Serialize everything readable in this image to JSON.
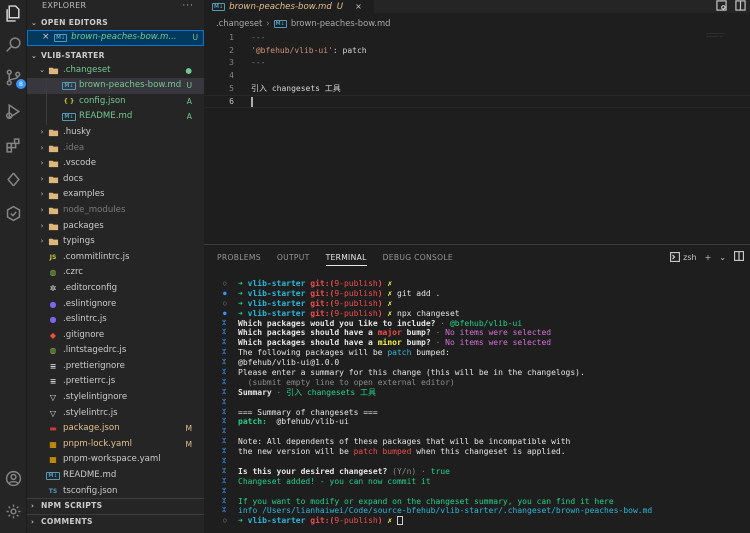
{
  "activity": {
    "scm_badge": "8"
  },
  "sidebar": {
    "title": "EXPLORER",
    "more": "···",
    "open_editors": {
      "header": "OPEN EDITORS",
      "items": [
        {
          "close": "×",
          "name": "brown-peaches-bow.m...",
          "status": "U"
        }
      ]
    },
    "project_header": "VLIB-STARTER",
    "tree": [
      {
        "type": "folder",
        "name": ".changeset",
        "open": true,
        "depth": 0,
        "status": "●",
        "color": "untracked"
      },
      {
        "type": "md",
        "name": "brown-peaches-bow.md",
        "depth": 1,
        "status": "U",
        "color": "untracked",
        "selected": true
      },
      {
        "type": "json",
        "name": "config.json",
        "depth": 1,
        "status": "A",
        "color": "add"
      },
      {
        "type": "md",
        "name": "README.md",
        "depth": 1,
        "status": "A",
        "color": "add"
      },
      {
        "type": "folder",
        "name": ".husky",
        "depth": 0
      },
      {
        "type": "folder",
        "name": ".idea",
        "depth": 0,
        "dim": true
      },
      {
        "type": "folder",
        "name": ".vscode",
        "depth": 0
      },
      {
        "type": "folder",
        "name": "docs",
        "depth": 0
      },
      {
        "type": "folder",
        "name": "examples",
        "depth": 0
      },
      {
        "type": "folder",
        "name": "node_modules",
        "depth": 0,
        "dim": true
      },
      {
        "type": "folder",
        "name": "packages",
        "depth": 0
      },
      {
        "type": "folder",
        "name": "typings",
        "depth": 0
      },
      {
        "type": "js",
        "name": ".commitlintrc.js",
        "depth": 0
      },
      {
        "type": "cfg",
        "name": ".czrc",
        "depth": 0
      },
      {
        "type": "editorconfig",
        "name": ".editorconfig",
        "depth": 0
      },
      {
        "type": "eslint",
        "name": ".eslintignore",
        "depth": 0
      },
      {
        "type": "eslint",
        "name": ".eslintrc.js",
        "depth": 0
      },
      {
        "type": "git",
        "name": ".gitignore",
        "depth": 0
      },
      {
        "type": "cfg",
        "name": ".lintstagedrc.js",
        "depth": 0
      },
      {
        "type": "lines",
        "name": ".prettierignore",
        "depth": 0
      },
      {
        "type": "lines",
        "name": ".prettierrc.js",
        "depth": 0
      },
      {
        "type": "stylelint",
        "name": ".stylelintignore",
        "depth": 0
      },
      {
        "type": "stylelint",
        "name": ".stylelintrc.js",
        "depth": 0
      },
      {
        "type": "npm",
        "name": "package.json",
        "depth": 0,
        "status": "M",
        "color": "mod"
      },
      {
        "type": "pnpm",
        "name": "pnpm-lock.yaml",
        "depth": 0,
        "status": "M",
        "color": "mod"
      },
      {
        "type": "pnpm",
        "name": "pnpm-workspace.yaml",
        "depth": 0
      },
      {
        "type": "md",
        "name": "README.md",
        "depth": 0
      },
      {
        "type": "ts",
        "name": "tsconfig.json",
        "depth": 0
      }
    ],
    "npm_scripts": "NPM SCRIPTS",
    "comments": "COMMENTS"
  },
  "editor": {
    "tab": {
      "name": "brown-peaches-bow.md",
      "status": "U",
      "close": "×"
    },
    "breadcrumb": {
      "folder": ".changeset",
      "sep": "›",
      "file": "brown-peaches-bow.md"
    },
    "lines": [
      {
        "n": "1",
        "parts": [
          {
            "t": "---",
            "c": "punct"
          }
        ]
      },
      {
        "n": "2",
        "parts": [
          {
            "t": "'@bfehub/vlib-ui'",
            "c": "str"
          },
          {
            "t": ": patch",
            "c": "plain"
          }
        ]
      },
      {
        "n": "3",
        "parts": [
          {
            "t": "---",
            "c": "punct"
          }
        ]
      },
      {
        "n": "4",
        "parts": []
      },
      {
        "n": "5",
        "parts": [
          {
            "t": "引入 changesets 工具",
            "c": "plain"
          }
        ]
      },
      {
        "n": "6",
        "parts": [],
        "current": true
      }
    ],
    "minimap": [
      "———————",
      "————— —"
    ]
  },
  "panel": {
    "tabs": [
      {
        "label": "PROBLEMS",
        "active": false
      },
      {
        "label": "OUTPUT",
        "active": false
      },
      {
        "label": "TERMINAL",
        "active": true
      },
      {
        "label": "DEBUG CONSOLE",
        "active": false
      }
    ],
    "shell": "zsh",
    "terminal": [
      {
        "g": "o",
        "s": [
          [
            "➜ ",
            "arw"
          ],
          [
            "vlib-starter ",
            "cyanb"
          ],
          [
            "git:(",
            "redb"
          ],
          [
            "9-publish",
            "red"
          ],
          [
            ")",
            "redb"
          ],
          [
            " ✗",
            "yellowb"
          ]
        ]
      },
      {
        "g": "b",
        "s": [
          [
            "➜ ",
            "arw"
          ],
          [
            "vlib-starter ",
            "cyanb"
          ],
          [
            "git:(",
            "redb"
          ],
          [
            "9-publish",
            "red"
          ],
          [
            ")",
            "redb"
          ],
          [
            " ✗",
            "yellowb"
          ],
          [
            " git add .",
            "white"
          ]
        ]
      },
      {
        "g": "o",
        "s": [
          [
            "➜ ",
            "arw"
          ],
          [
            "vlib-starter ",
            "cyanb"
          ],
          [
            "git:(",
            "redb"
          ],
          [
            "9-publish",
            "red"
          ],
          [
            ")",
            "redb"
          ],
          [
            " ✗",
            "yellowb"
          ]
        ]
      },
      {
        "g": "b",
        "s": [
          [
            "➜ ",
            "arw"
          ],
          [
            "vlib-starter ",
            "cyanb"
          ],
          [
            "git:(",
            "redb"
          ],
          [
            "9-publish",
            "red"
          ],
          [
            ")",
            "redb"
          ],
          [
            " ✗",
            "yellowb"
          ],
          [
            " npx changeset",
            "white"
          ]
        ]
      },
      {
        "g": "m",
        "s": [
          [
            "Which packages would you like to include?",
            "bold white"
          ],
          [
            " · ",
            "gray"
          ],
          [
            "@bfehub/vlib-ui",
            "green"
          ]
        ]
      },
      {
        "g": "m",
        "s": [
          [
            "Which packages should have a ",
            "bold white"
          ],
          [
            "major",
            "redb"
          ],
          [
            " bump?",
            "bold white"
          ],
          [
            " · ",
            "gray"
          ],
          [
            "No items were selected",
            "magenta"
          ]
        ]
      },
      {
        "g": "m",
        "s": [
          [
            "Which packages should have a ",
            "bold white"
          ],
          [
            "minor",
            "yellowb"
          ],
          [
            " bump?",
            "bold white"
          ],
          [
            " · ",
            "gray"
          ],
          [
            "No items were selected",
            "magenta"
          ]
        ]
      },
      {
        "g": "m",
        "s": [
          [
            "The following packages will be ",
            "white"
          ],
          [
            "patch",
            "cyan"
          ],
          [
            " bumped:",
            "white"
          ]
        ]
      },
      {
        "g": "m",
        "s": [
          [
            "@bfehub/vlib-ui@1.0.0",
            "white"
          ]
        ]
      },
      {
        "g": "m",
        "s": [
          [
            "Please enter a summary for this change (this will be in the changelogs).",
            "white"
          ]
        ]
      },
      {
        "g": "m",
        "s": [
          [
            "  (submit empty line to open external editor)",
            "gray"
          ]
        ]
      },
      {
        "g": "m",
        "s": [
          [
            "Summary",
            "bold white"
          ],
          [
            " · ",
            "gray"
          ],
          [
            "引入 changesets 工具",
            "green"
          ]
        ]
      },
      {
        "g": "m",
        "s": []
      },
      {
        "g": "m",
        "s": [
          [
            "=== Summary of changesets ===",
            "white"
          ]
        ]
      },
      {
        "g": "m",
        "s": [
          [
            "patch:",
            "bold green"
          ],
          [
            "  @bfehub/vlib-ui",
            "white"
          ]
        ]
      },
      {
        "g": "m",
        "s": []
      },
      {
        "g": "m",
        "s": [
          [
            "Note: All dependents of these packages that will be incompatible with",
            "white"
          ]
        ]
      },
      {
        "g": "m",
        "s": [
          [
            "the new version will be ",
            "white"
          ],
          [
            "patch bumped",
            "red"
          ],
          [
            " when this changeset is applied.",
            "white"
          ]
        ]
      },
      {
        "g": "m",
        "s": []
      },
      {
        "g": "m",
        "s": [
          [
            "Is this your desired changeset?",
            "bold white"
          ],
          [
            " (Y/n)",
            "gray"
          ],
          [
            " · ",
            "gray"
          ],
          [
            "true",
            "green"
          ]
        ]
      },
      {
        "g": "m",
        "s": [
          [
            "Changeset added! - you can now commit it",
            "green"
          ]
        ]
      },
      {
        "g": "m",
        "s": []
      },
      {
        "g": "m",
        "s": [
          [
            "If you want to modify or expand on the changeset summary, you can find it here",
            "green"
          ]
        ]
      },
      {
        "g": "m",
        "s": [
          [
            "info ",
            "cyan"
          ],
          [
            "/Users/lianhaiwei/Code/source-bfehub/vlib-starter/.changeset/brown-peaches-bow.md",
            "cyan"
          ]
        ]
      },
      {
        "g": "o",
        "s": [
          [
            "➜ ",
            "arw"
          ],
          [
            "vlib-starter ",
            "cyanb"
          ],
          [
            "git:(",
            "redb"
          ],
          [
            "9-publish",
            "red"
          ],
          [
            ")",
            "redb"
          ],
          [
            " ✗",
            "yellowb"
          ],
          [
            " ",
            "white"
          ]
        ],
        "cursor": true
      }
    ]
  }
}
